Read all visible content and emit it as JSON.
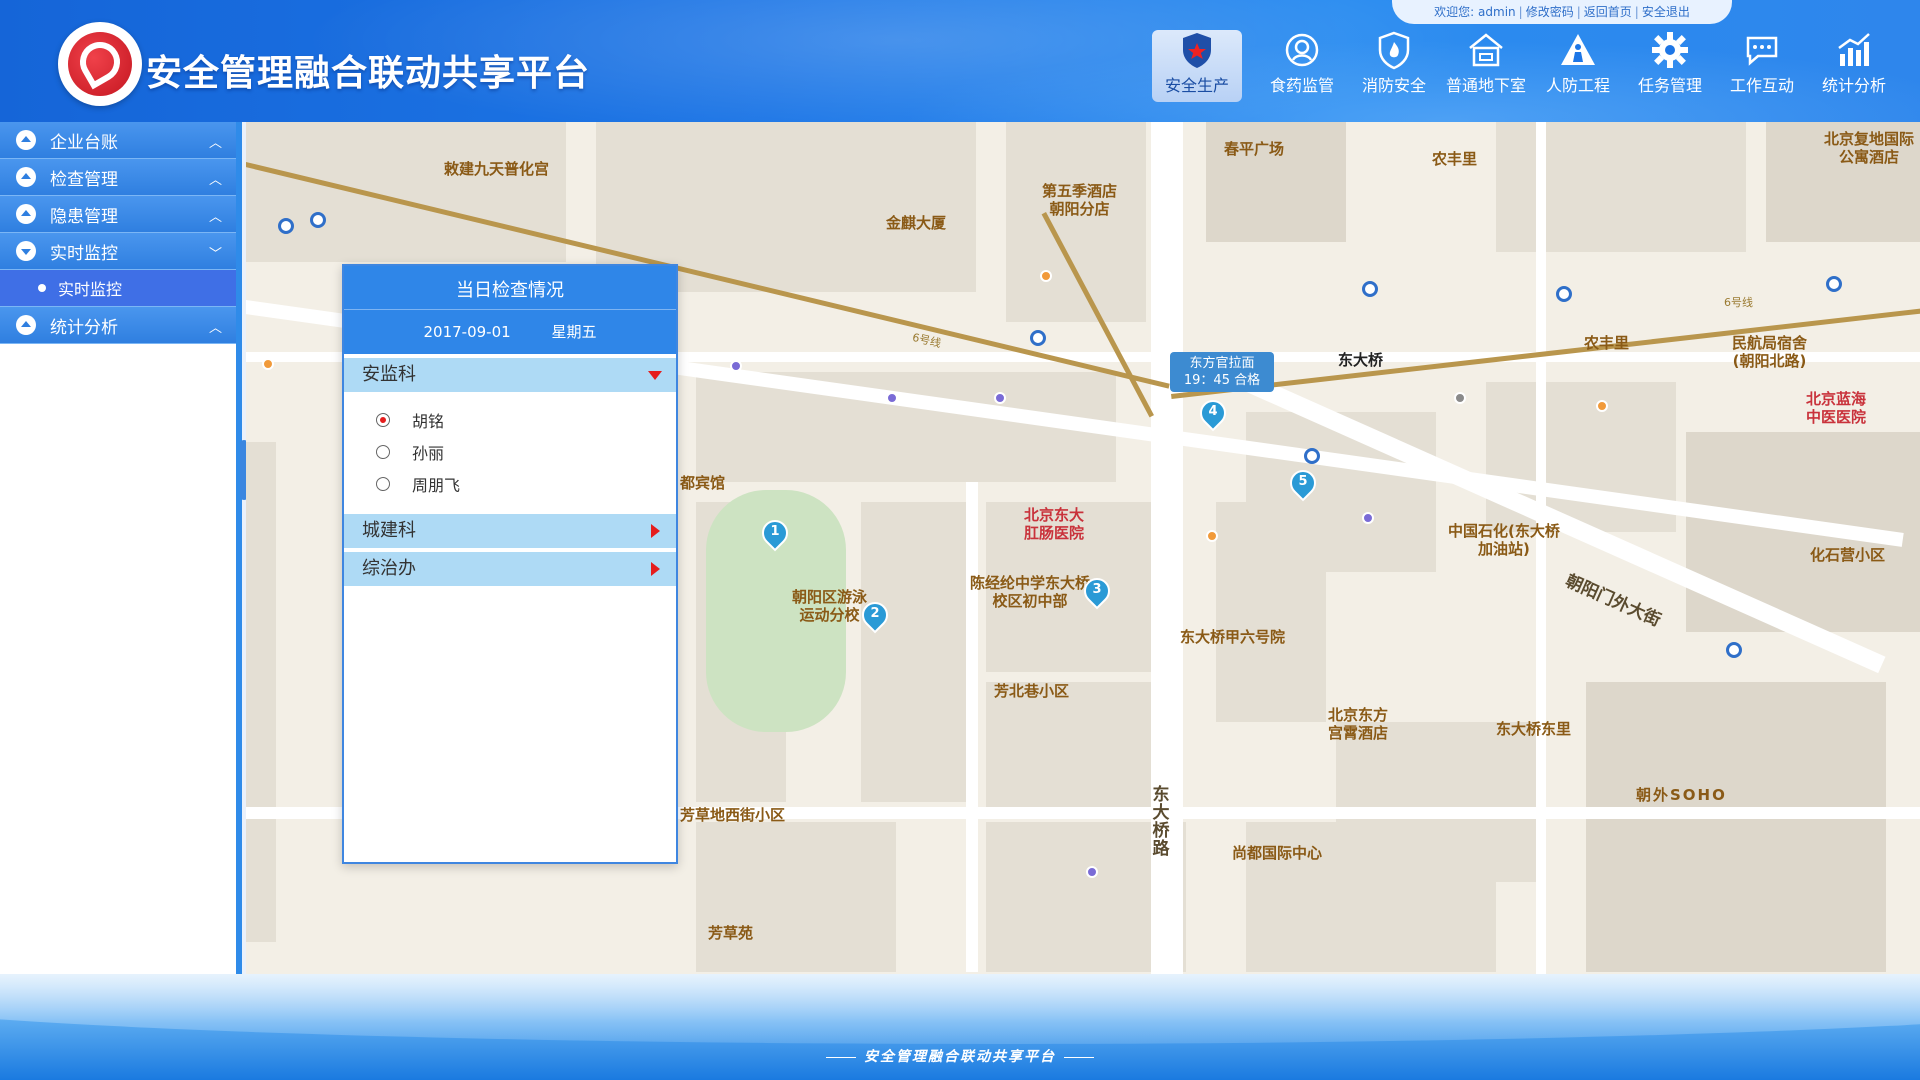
{
  "app": {
    "title": "安全管理融合联动共享平台",
    "footer_text": "安全管理融合联动共享平台"
  },
  "user_bar": {
    "welcome": "欢迎您: admin",
    "change_password": "修改密码",
    "back_home": "返回首页",
    "logout": "安全退出"
  },
  "nav": [
    {
      "label": "安全生产",
      "icon": "police-badge-icon",
      "active": true
    },
    {
      "label": "食药监管",
      "icon": "food-drug-icon"
    },
    {
      "label": "消防安全",
      "icon": "fire-shield-icon"
    },
    {
      "label": "普通地下室",
      "icon": "basement-house-icon"
    },
    {
      "label": "人防工程",
      "icon": "civil-defense-icon"
    },
    {
      "label": "任务管理",
      "icon": "gear-icon"
    },
    {
      "label": "工作互动",
      "icon": "chat-icon"
    },
    {
      "label": "统计分析",
      "icon": "bar-chart-icon"
    }
  ],
  "sidebar": {
    "items": [
      {
        "label": "企业台账"
      },
      {
        "label": "检查管理"
      },
      {
        "label": "隐患管理"
      },
      {
        "label": "实时监控",
        "expanded": true
      },
      {
        "label": "统计分析"
      }
    ],
    "sub_items": [
      {
        "label": "实时监控"
      }
    ]
  },
  "panel": {
    "title": "当日检查情况",
    "date": "2017-09-01",
    "weekday": "星期五",
    "departments": [
      {
        "name": "安监科",
        "expanded": true
      },
      {
        "name": "城建科"
      },
      {
        "name": "综治办"
      }
    ],
    "people": [
      {
        "name": "胡铭",
        "selected": true
      },
      {
        "name": "孙丽"
      },
      {
        "name": "周朋飞"
      }
    ]
  },
  "map": {
    "station_popup": {
      "line1": "东方官拉面",
      "line2": "19：45  合格"
    },
    "pins": [
      "1",
      "2",
      "3",
      "4",
      "5"
    ],
    "labels": {
      "l1": "敕建九天普化宫",
      "l2": "金麒大厦",
      "l3": "第五季酒店\n朝阳分店",
      "l4": "春平广场",
      "l5": "农丰里",
      "l6": "北京复地国际\n公寓酒店",
      "l7": "东大桥",
      "l8": "农丰里",
      "l9": "民航局宿舍\n(朝阳北路)",
      "l10": "北京蓝海\n中医医院",
      "l11": "都宾馆",
      "l12": "北京东大\n肛肠医院",
      "l13": "中国石化(东大桥\n加油站)",
      "l14": "化石营小区",
      "l15": "朝阳区游泳\n运动分校",
      "l16": "陈经纶中学东大桥\n校区初中部",
      "l17": "东大桥甲六号院",
      "l18": "芳北巷小区",
      "l19": "北京东方\n宫霄酒店",
      "l20": "东大桥东里",
      "l21": "朝外SOHO",
      "l22": "芳草地西街小区",
      "l23": "尚都国际中心",
      "l24": "芳草苑",
      "l25": "东大桥路",
      "l26": "朝阳门外大街",
      "l27": "6号线",
      "l28": "6号线"
    }
  }
}
